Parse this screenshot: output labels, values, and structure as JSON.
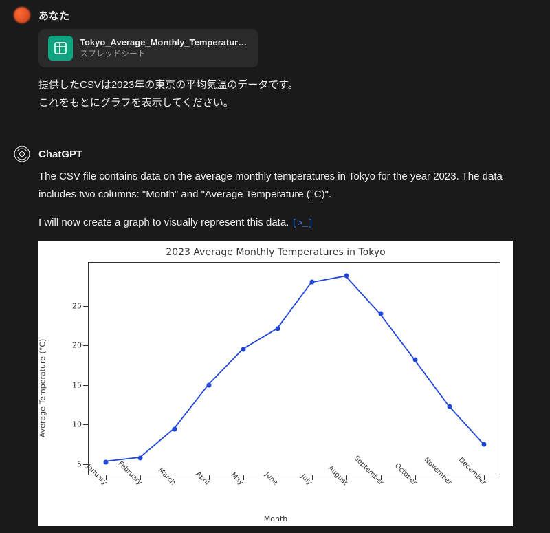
{
  "user": {
    "name": "あなた",
    "attachment": {
      "filename": "Tokyo_Average_Monthly_Temperatures...",
      "filetype": "スプレッドシート"
    },
    "line1": "提供したCSVは2023年の東京の平均気温のデータです。",
    "line2": "これをもとにグラフを表示してください。"
  },
  "assistant": {
    "name": "ChatGPT",
    "para1": "The CSV file contains data on the average monthly temperatures in Tokyo for the year 2023. The data includes two columns: \"Month\" and \"Average Temperature (°C)\".",
    "para2_prefix": "I will now create a graph to visually represent this data. ",
    "code_badge": "[>_]"
  },
  "chart_data": {
    "type": "line",
    "title": "2023 Average Monthly Temperatures in Tokyo",
    "xlabel": "Month",
    "ylabel": "Average Temperature (°C)",
    "categories": [
      "January",
      "February",
      "March",
      "April",
      "May",
      "June",
      "July",
      "August",
      "September",
      "October",
      "November",
      "December"
    ],
    "values": [
      5.2,
      5.7,
      9.4,
      15.0,
      19.5,
      22.1,
      28.0,
      28.8,
      24.0,
      18.2,
      12.3,
      7.5
    ],
    "yticks": [
      5,
      10,
      15,
      20,
      25
    ],
    "ylim": [
      3.5,
      30.5
    ]
  }
}
